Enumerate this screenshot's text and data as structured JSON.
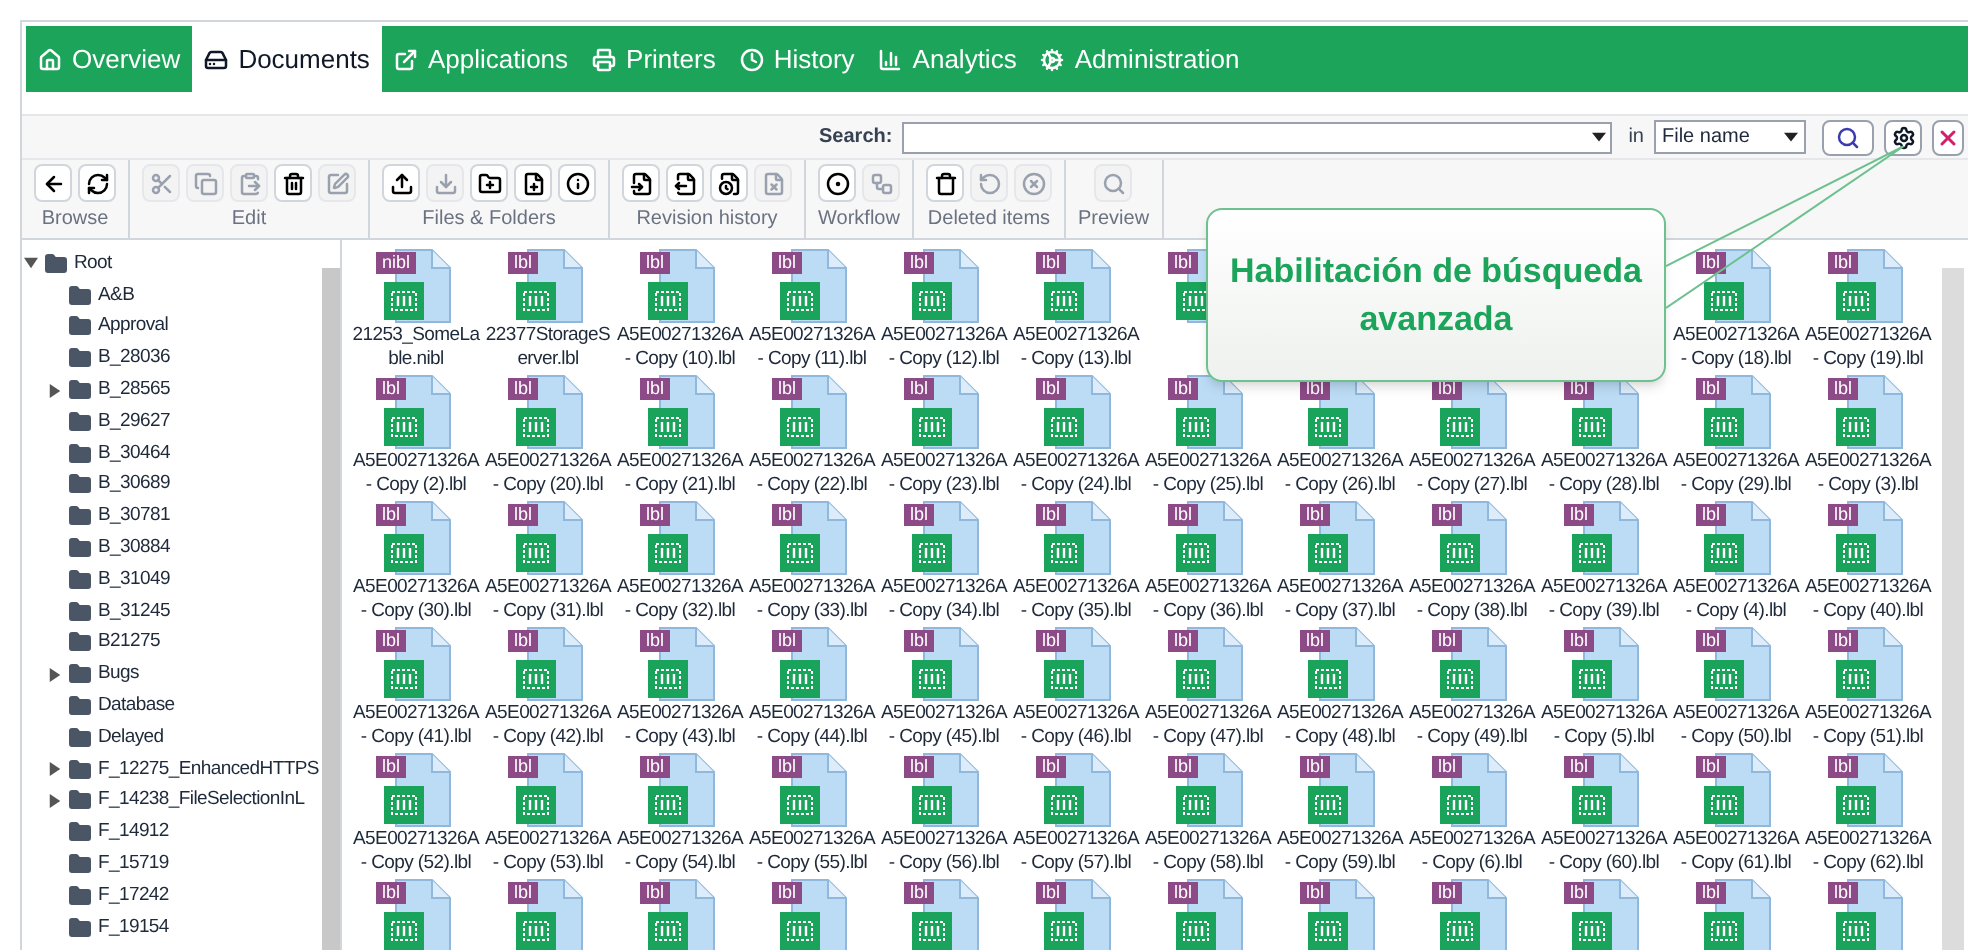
{
  "tabs": [
    {
      "label": "Overview",
      "selected": false
    },
    {
      "label": "Documents",
      "selected": true
    },
    {
      "label": "Applications",
      "selected": false
    },
    {
      "label": "Printers",
      "selected": false
    },
    {
      "label": "History",
      "selected": false
    },
    {
      "label": "Analytics",
      "selected": false
    },
    {
      "label": "Administration",
      "selected": false
    }
  ],
  "search": {
    "label": "Search:",
    "in_label": "in",
    "scope": "File name"
  },
  "toolbar": [
    {
      "label": "Browse",
      "buttons": [
        {
          "kind": "back",
          "disabled": false
        },
        {
          "kind": "refresh",
          "disabled": false
        }
      ]
    },
    {
      "label": "Edit",
      "buttons": [
        {
          "kind": "cut",
          "disabled": true
        },
        {
          "kind": "copy",
          "disabled": true
        },
        {
          "kind": "paste",
          "disabled": true
        },
        {
          "kind": "delete",
          "disabled": false
        },
        {
          "kind": "edit",
          "disabled": true
        }
      ]
    },
    {
      "label": "Files & Folders",
      "buttons": [
        {
          "kind": "upload",
          "disabled": false
        },
        {
          "kind": "download",
          "disabled": true
        },
        {
          "kind": "newfolder",
          "disabled": false
        },
        {
          "kind": "newfile",
          "disabled": false
        },
        {
          "kind": "info",
          "disabled": false
        }
      ]
    },
    {
      "label": "Revision history",
      "buttons": [
        {
          "kind": "checkin",
          "disabled": false
        },
        {
          "kind": "checkout",
          "disabled": false
        },
        {
          "kind": "history",
          "disabled": false
        },
        {
          "kind": "discard",
          "disabled": true
        }
      ]
    },
    {
      "label": "Workflow",
      "buttons": [
        {
          "kind": "cycle",
          "disabled": false
        },
        {
          "kind": "transition",
          "disabled": true
        }
      ]
    },
    {
      "label": "Deleted items",
      "buttons": [
        {
          "kind": "bin",
          "disabled": false
        },
        {
          "kind": "restore",
          "disabled": true
        },
        {
          "kind": "purge",
          "disabled": true
        }
      ]
    },
    {
      "label": "Preview",
      "buttons": [
        {
          "kind": "preview",
          "disabled": true
        }
      ]
    }
  ],
  "tree": [
    {
      "label": "Root",
      "expanded": true,
      "children": [
        {
          "label": "A&B"
        },
        {
          "label": "Approval"
        },
        {
          "label": "B_28036"
        },
        {
          "label": "B_28565",
          "expanded": false
        },
        {
          "label": "B_29627"
        },
        {
          "label": "B_30464"
        },
        {
          "label": "B_30689"
        },
        {
          "label": "B_30781"
        },
        {
          "label": "B_30884"
        },
        {
          "label": "B_31049"
        },
        {
          "label": "B_31245"
        },
        {
          "label": "B21275"
        },
        {
          "label": "Bugs",
          "expanded": false
        },
        {
          "label": "Database"
        },
        {
          "label": "Delayed"
        },
        {
          "label": "F_12275_EnhancedHTTPS",
          "expanded": false
        },
        {
          "label": "F_14238_FileSelectionInL",
          "expanded": false
        },
        {
          "label": "F_14912"
        },
        {
          "label": "F_15719"
        },
        {
          "label": "F_17242"
        },
        {
          "label": "F_19154"
        }
      ]
    }
  ],
  "files": [
    {
      "kind": "file",
      "badge": "nibl",
      "name": "21253_SomeLable.nibl"
    },
    {
      "kind": "file",
      "badge": "lbl",
      "name": "22377StorageServer.lbl"
    },
    {
      "kind": "file",
      "badge": "lbl",
      "name": "A5E00271326A - Copy (10).lbl"
    },
    {
      "kind": "file",
      "badge": "lbl",
      "name": "A5E00271326A - Copy (11).lbl"
    },
    {
      "kind": "file",
      "badge": "lbl",
      "name": "A5E00271326A - Copy (12).lbl"
    },
    {
      "kind": "file",
      "badge": "lbl",
      "name": "A5E00271326A - Copy (13).lbl"
    },
    {
      "kind": "file",
      "badge": "lbl"
    },
    {
      "kind": "covered"
    },
    {
      "kind": "covered"
    },
    {
      "kind": "covered"
    },
    {
      "kind": "file",
      "badge": "lbl",
      "name": "A5E00271326A - Copy (18).lbl"
    },
    {
      "kind": "file",
      "badge": "lbl",
      "name": "A5E00271326A - Copy (19).lbl"
    },
    {
      "kind": "file",
      "badge": "lbl",
      "name": "A5E00271326A - Copy (2).lbl"
    },
    {
      "kind": "file",
      "badge": "lbl",
      "name": "A5E00271326A - Copy (20).lbl"
    },
    {
      "kind": "file",
      "badge": "lbl",
      "name": "A5E00271326A - Copy (21).lbl"
    },
    {
      "kind": "file",
      "badge": "lbl",
      "name": "A5E00271326A - Copy (22).lbl"
    },
    {
      "kind": "file",
      "badge": "lbl",
      "name": "A5E00271326A - Copy (23).lbl"
    },
    {
      "kind": "file",
      "badge": "lbl",
      "name": "A5E00271326A - Copy (24).lbl"
    },
    {
      "kind": "file",
      "badge": "lbl",
      "name": "A5E00271326A - Copy (25).lbl"
    },
    {
      "kind": "file",
      "badge": "lbl",
      "name": "A5E00271326A - Copy (26).lbl"
    },
    {
      "kind": "file",
      "badge": "lbl",
      "name": "A5E00271326A - Copy (27).lbl"
    },
    {
      "kind": "file",
      "badge": "lbl",
      "name": "A5E00271326A - Copy (28).lbl"
    },
    {
      "kind": "file",
      "badge": "lbl",
      "name": "A5E00271326A - Copy (29).lbl"
    },
    {
      "kind": "file",
      "badge": "lbl",
      "name": "A5E00271326A - Copy (3).lbl"
    },
    {
      "kind": "file",
      "badge": "lbl",
      "name": "A5E00271326A - Copy (30).lbl"
    },
    {
      "kind": "file",
      "badge": "lbl",
      "name": "A5E00271326A - Copy (31).lbl"
    },
    {
      "kind": "file",
      "badge": "lbl",
      "name": "A5E00271326A - Copy (32).lbl"
    },
    {
      "kind": "file",
      "badge": "lbl",
      "name": "A5E00271326A - Copy (33).lbl"
    },
    {
      "kind": "file",
      "badge": "lbl",
      "name": "A5E00271326A - Copy (34).lbl"
    },
    {
      "kind": "file",
      "badge": "lbl",
      "name": "A5E00271326A - Copy (35).lbl"
    },
    {
      "kind": "file",
      "badge": "lbl",
      "name": "A5E00271326A - Copy (36).lbl"
    },
    {
      "kind": "file",
      "badge": "lbl",
      "name": "A5E00271326A - Copy (37).lbl"
    },
    {
      "kind": "file",
      "badge": "lbl",
      "name": "A5E00271326A - Copy (38).lbl"
    },
    {
      "kind": "file",
      "badge": "lbl",
      "name": "A5E00271326A - Copy (39).lbl"
    },
    {
      "kind": "file",
      "badge": "lbl",
      "name": "A5E00271326A - Copy (4).lbl"
    },
    {
      "kind": "file",
      "badge": "lbl",
      "name": "A5E00271326A - Copy (40).lbl"
    },
    {
      "kind": "file",
      "badge": "lbl",
      "name": "A5E00271326A - Copy (41).lbl"
    },
    {
      "kind": "file",
      "badge": "lbl",
      "name": "A5E00271326A - Copy (42).lbl"
    },
    {
      "kind": "file",
      "badge": "lbl",
      "name": "A5E00271326A - Copy (43).lbl"
    },
    {
      "kind": "file",
      "badge": "lbl",
      "name": "A5E00271326A - Copy (44).lbl"
    },
    {
      "kind": "file",
      "badge": "lbl",
      "name": "A5E00271326A - Copy (45).lbl"
    },
    {
      "kind": "file",
      "badge": "lbl",
      "name": "A5E00271326A - Copy (46).lbl"
    },
    {
      "kind": "file",
      "badge": "lbl",
      "name": "A5E00271326A - Copy (47).lbl"
    },
    {
      "kind": "file",
      "badge": "lbl",
      "name": "A5E00271326A - Copy (48).lbl"
    },
    {
      "kind": "file",
      "badge": "lbl",
      "name": "A5E00271326A - Copy (49).lbl"
    },
    {
      "kind": "file",
      "badge": "lbl",
      "name": "A5E00271326A - Copy (5).lbl"
    },
    {
      "kind": "file",
      "badge": "lbl",
      "name": "A5E00271326A - Copy (50).lbl"
    },
    {
      "kind": "file",
      "badge": "lbl",
      "name": "A5E00271326A - Copy (51).lbl"
    },
    {
      "kind": "file",
      "badge": "lbl",
      "name": "A5E00271326A - Copy (52).lbl"
    },
    {
      "kind": "file",
      "badge": "lbl",
      "name": "A5E00271326A - Copy (53).lbl"
    },
    {
      "kind": "file",
      "badge": "lbl",
      "name": "A5E00271326A - Copy (54).lbl"
    },
    {
      "kind": "file",
      "badge": "lbl",
      "name": "A5E00271326A - Copy (55).lbl"
    },
    {
      "kind": "file",
      "badge": "lbl",
      "name": "A5E00271326A - Copy (56).lbl"
    },
    {
      "kind": "file",
      "badge": "lbl",
      "name": "A5E00271326A - Copy (57).lbl"
    },
    {
      "kind": "file",
      "badge": "lbl",
      "name": "A5E00271326A - Copy (58).lbl"
    },
    {
      "kind": "file",
      "badge": "lbl",
      "name": "A5E00271326A - Copy (59).lbl"
    },
    {
      "kind": "file",
      "badge": "lbl",
      "name": "A5E00271326A - Copy (6).lbl"
    },
    {
      "kind": "file",
      "badge": "lbl",
      "name": "A5E00271326A - Copy (60).lbl"
    },
    {
      "kind": "file",
      "badge": "lbl",
      "name": "A5E00271326A - Copy (61).lbl"
    },
    {
      "kind": "file",
      "badge": "lbl",
      "name": "A5E00271326A - Copy (62).lbl"
    },
    {
      "kind": "file",
      "badge": "lbl"
    },
    {
      "kind": "file",
      "badge": "lbl"
    },
    {
      "kind": "file",
      "badge": "lbl"
    },
    {
      "kind": "file",
      "badge": "lbl"
    },
    {
      "kind": "file",
      "badge": "lbl"
    },
    {
      "kind": "file",
      "badge": "lbl"
    },
    {
      "kind": "file",
      "badge": "lbl"
    },
    {
      "kind": "file",
      "badge": "lbl"
    },
    {
      "kind": "file",
      "badge": "lbl"
    },
    {
      "kind": "file",
      "badge": "lbl"
    },
    {
      "kind": "file",
      "badge": "lbl"
    },
    {
      "kind": "file",
      "badge": "lbl"
    }
  ],
  "callout": {
    "text": "Habilitación de búsqueda avanzada"
  }
}
